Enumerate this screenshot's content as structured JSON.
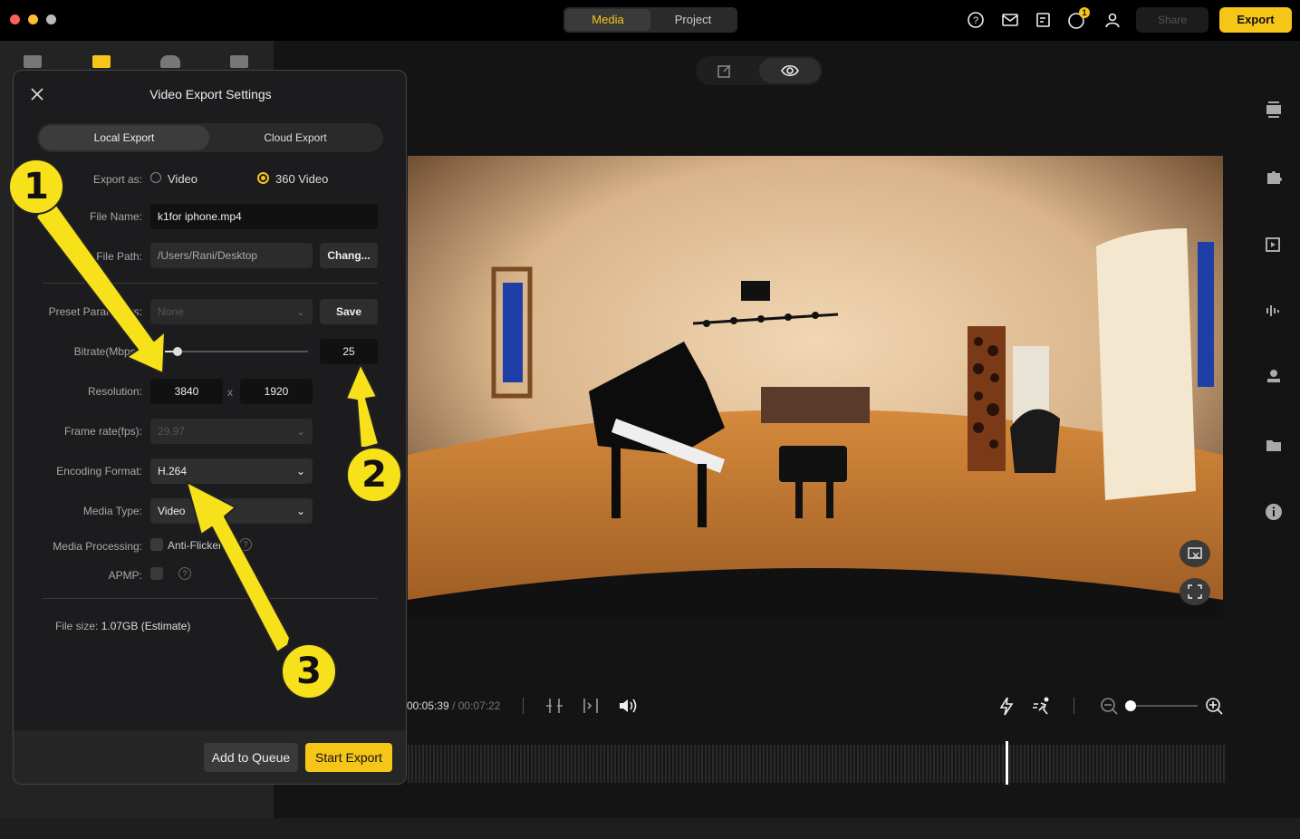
{
  "topbar": {
    "tabs": [
      "Media",
      "Project"
    ],
    "share_label": "Share",
    "export_label": "Export",
    "badge_count": "1"
  },
  "dialog": {
    "title": "Video Export Settings",
    "tabs": [
      "Local Export",
      "Cloud Export"
    ],
    "export_as_label": "Export as:",
    "export_options": [
      "Video",
      "360 Video"
    ],
    "file_name_label": "File Name:",
    "file_name_value": "k1for iphone.mp4",
    "file_path_label": "File Path:",
    "file_path_value": "/Users/Rani/Desktop",
    "change_label": "Chang...",
    "preset_label": "Preset Parameters:",
    "preset_value": "None",
    "save_label": "Save",
    "bitrate_label": "Bitrate(Mbps):",
    "bitrate_value": "25",
    "bitrate_level": 0.1,
    "resolution_label": "Resolution:",
    "resolution_width": "3840",
    "resolution_x": "x",
    "resolution_height": "1920",
    "frame_rate_label": "Frame rate(fps):",
    "frame_rate_value": "29.97",
    "encoding_label": "Encoding Format:",
    "encoding_value": "H.264",
    "media_type_label": "Media Type:",
    "media_type_value": "Video",
    "media_processing_label": "Media Processing:",
    "anti_flicker_label": "Anti-Flicker",
    "apmp_label": "APMP:",
    "file_size_label": "File size:",
    "file_size_value": "1.07GB (Estimate)",
    "add_queue_label": "Add to Queue",
    "start_export_label": "Start Export"
  },
  "player": {
    "current_time": "00:05:39",
    "separator": "/",
    "total_time": "00:07:22"
  },
  "callouts": [
    "1",
    "2",
    "3"
  ],
  "colors": {
    "accent": "#f5c518",
    "callout": "#f7e11b"
  }
}
